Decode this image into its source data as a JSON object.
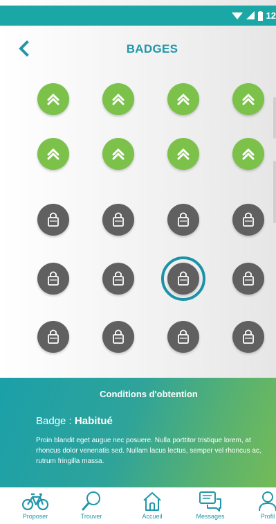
{
  "status_bar": {
    "time": "12",
    "icons": [
      "wifi-icon",
      "signal-icon",
      "battery-icon"
    ],
    "color": "#1aa7a6"
  },
  "header": {
    "title": "BADGES",
    "back_icon": "chevron-left-icon"
  },
  "badges": {
    "unlocked_color": "#7bc14a",
    "locked_color": "#606060",
    "selected_ring_color": "#1a93a8",
    "rows": [
      [
        "unlocked",
        "unlocked",
        "unlocked",
        "unlocked"
      ],
      [
        "unlocked",
        "unlocked",
        "unlocked",
        "unlocked"
      ],
      [
        "locked",
        "locked",
        "locked",
        "locked"
      ],
      [
        "locked",
        "locked",
        "locked-selected",
        "locked"
      ],
      [
        "locked",
        "locked",
        "locked",
        "locked"
      ]
    ]
  },
  "conditions": {
    "title": "Conditions d'obtention",
    "badge_prefix": "Badge : ",
    "badge_name": "Habitué",
    "description": "Proin blandit eget augue nec posuere. Nulla porttitor tristique lorem, at rhoncus dolor venenatis sed. Nullam lacus lectus, semper vel rhoncus ac, rutrum fringilla massa."
  },
  "nav": {
    "items": [
      {
        "label": "Proposer",
        "icon": "bicycle-icon"
      },
      {
        "label": "Trouver",
        "icon": "search-icon"
      },
      {
        "label": "Accueil",
        "icon": "home-icon"
      },
      {
        "label": "Messages",
        "icon": "messages-icon"
      },
      {
        "label": "Profil",
        "icon": "profile-icon"
      }
    ],
    "color": "#1f97a9"
  }
}
